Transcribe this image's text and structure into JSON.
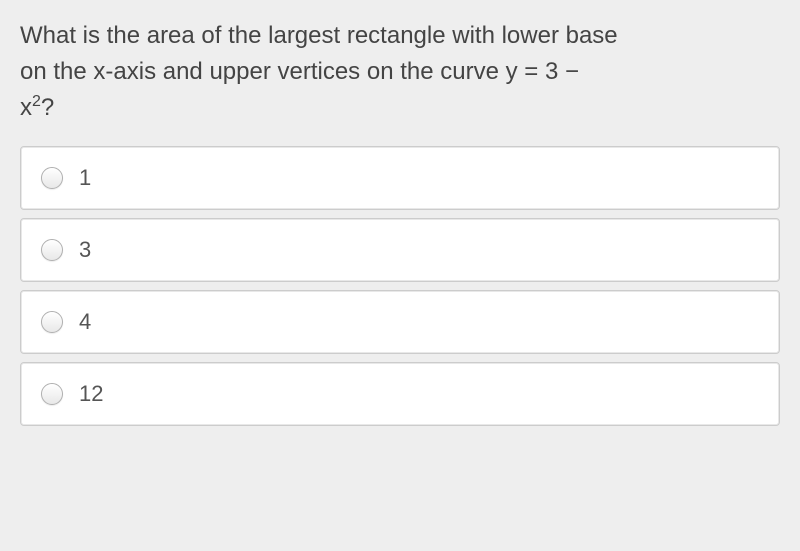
{
  "question": {
    "line1": "What is the area of the largest rectangle with lower base",
    "line2_part1": "on the x-axis and upper vertices on the curve y = 3 −",
    "line3_part1": "x",
    "line3_sup": "2",
    "line3_part2": "?"
  },
  "options": [
    {
      "label": "1"
    },
    {
      "label": "3"
    },
    {
      "label": "4"
    },
    {
      "label": "12"
    }
  ]
}
